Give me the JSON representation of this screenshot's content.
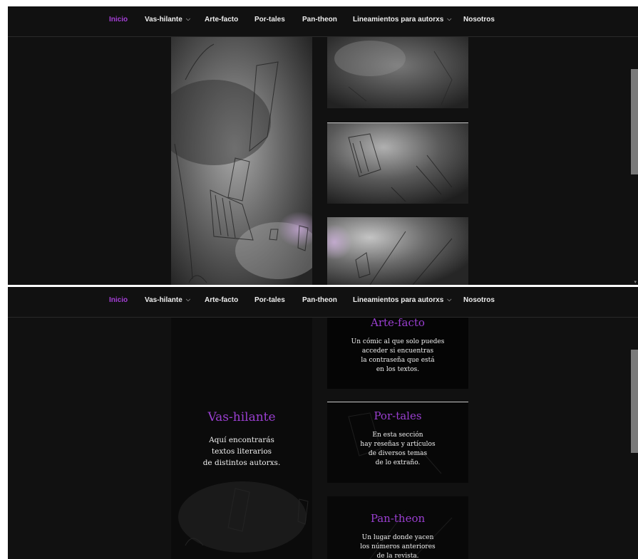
{
  "nav": {
    "items": [
      {
        "label": "Inicio",
        "active": true,
        "dropdown": false
      },
      {
        "label": "Vas-hilante",
        "active": false,
        "dropdown": true
      },
      {
        "label": "Arte-facto",
        "active": false,
        "dropdown": false
      },
      {
        "label": "Por-tales",
        "active": false,
        "dropdown": false
      },
      {
        "label": "Pan-theon",
        "active": false,
        "dropdown": false
      },
      {
        "label": "Lineamientos para autorxs",
        "active": false,
        "dropdown": true
      },
      {
        "label": "Nosotros",
        "active": false,
        "dropdown": false
      }
    ],
    "chevron_glyph": "⌵",
    "active_color": "#a63fd8"
  },
  "sections": {
    "vas_hilante": {
      "title": "Vas-hilante",
      "body": "Aquí encontrarás\ntextos literarios\nde distintos autorxs."
    },
    "arte_facto": {
      "title": "Arte-facto",
      "body": "Un cómic al que solo puedes\nacceder si encuentras\nla contraseña que está\nen los textos."
    },
    "por_tales": {
      "title": "Por-tales",
      "body": "En esta sección\nhay reseñas y artículos\nde diversos temas\nde lo extraño."
    },
    "pan_theon": {
      "title": "Pan-theon",
      "body": "Un lugar donde yacen\nlos números anteriores\nde la revista."
    }
  },
  "colors": {
    "background": "#111111",
    "accent": "#9a3fd0"
  }
}
